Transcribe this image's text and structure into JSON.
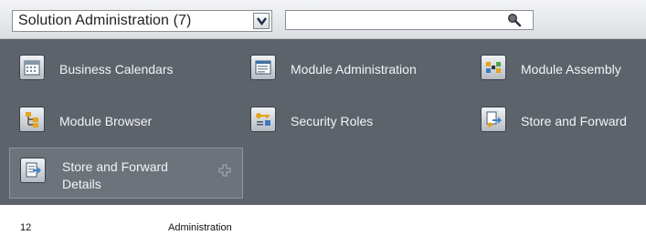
{
  "toolbar": {
    "module_select": {
      "selected": "Solution Administration (7)"
    },
    "search": {
      "value": ""
    }
  },
  "tiles": [
    {
      "label": "Business Calendars",
      "icon": "calendar-icon"
    },
    {
      "label": "Module Administration",
      "icon": "window-list-icon"
    },
    {
      "label": "Module Assembly",
      "icon": "module-assembly-icon"
    },
    {
      "label": "Module Browser",
      "icon": "tree-icon"
    },
    {
      "label": "Security Roles",
      "icon": "key-roles-icon"
    },
    {
      "label": "Store and Forward",
      "icon": "store-forward-icon"
    },
    {
      "label": "Store and Forward Details",
      "icon": "store-forward-details-icon",
      "selected": true
    }
  ],
  "footer": {
    "page_number": "12",
    "section": "Administration"
  }
}
